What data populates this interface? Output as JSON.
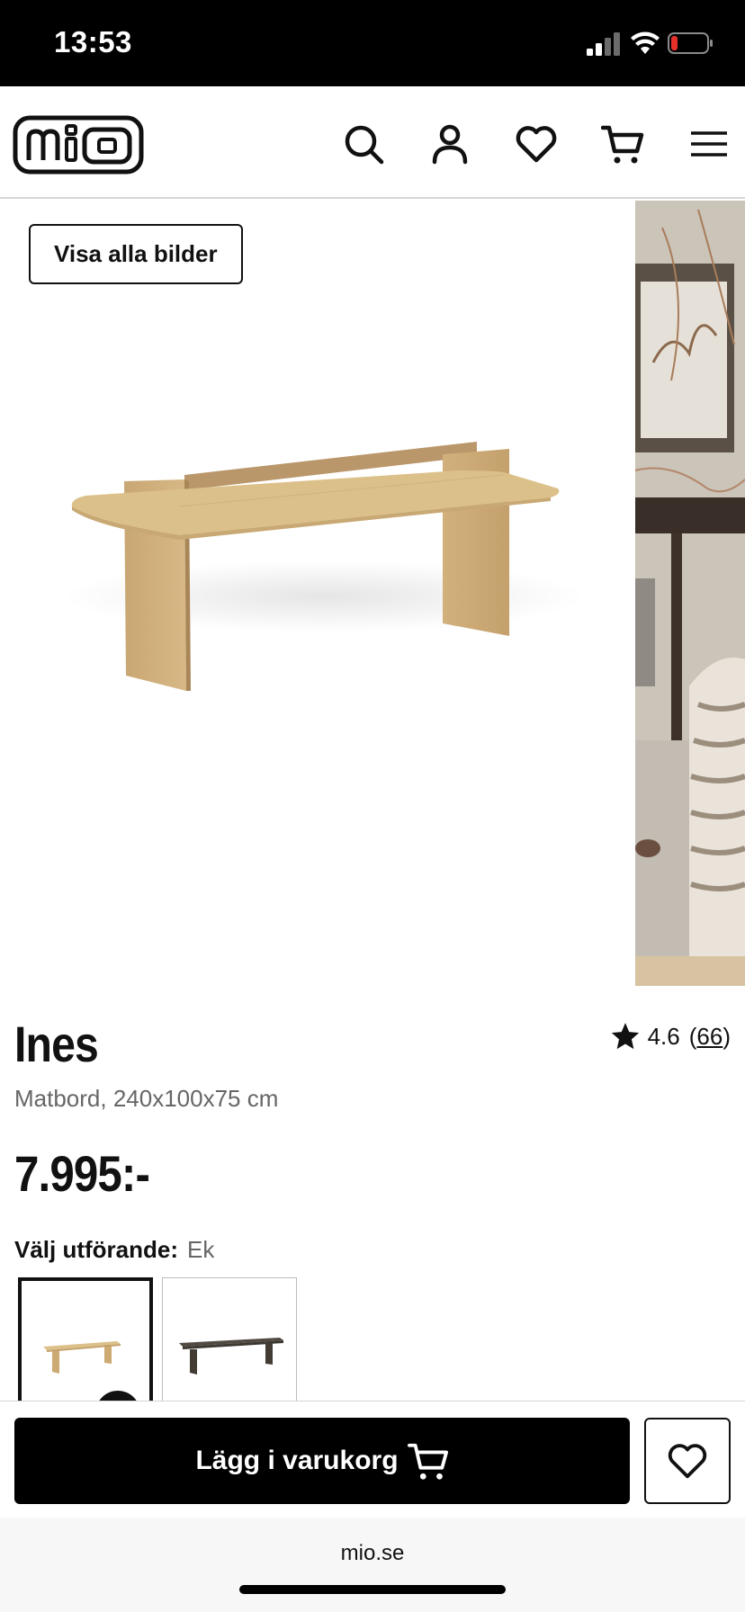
{
  "status_bar": {
    "time": "13:53",
    "icons": [
      "cellular-signal-icon",
      "wifi-icon",
      "battery-low-icon"
    ],
    "battery_color": "#e5302a"
  },
  "header": {
    "logo_text": "mio",
    "icons": [
      "search-icon",
      "account-icon",
      "heart-icon",
      "cart-icon",
      "menu-icon"
    ]
  },
  "gallery": {
    "view_all_label": "Visa alla bilder"
  },
  "product": {
    "name": "Ines",
    "rating": "4.6",
    "review_count": "66",
    "review_open": "(",
    "review_close": ")",
    "subtitle": "Matbord, 240x100x75 cm",
    "price": "7.995:-"
  },
  "variant": {
    "label": "Välj utförande:",
    "selected_value": "Ek",
    "options": [
      "oak",
      "dark"
    ]
  },
  "sticky_bar": {
    "add_to_cart_label": "Lägg i varukorg"
  },
  "browser": {
    "url": "mio.se"
  },
  "colors": {
    "primary": "#000000",
    "muted_text": "#666666",
    "oak": "#d9bd87",
    "dark_wood": "#4a423a"
  }
}
